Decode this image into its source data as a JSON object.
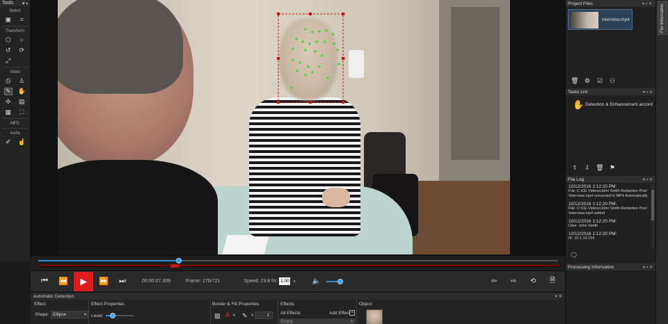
{
  "toolbar": {
    "title": "Tools",
    "sections": {
      "select": "Select",
      "transform": "Transform",
      "video": "Video",
      "mfd": "MFD",
      "audio": "Audio"
    }
  },
  "player": {
    "timecode": "00:00:07.339",
    "frame": "Frame: 176/721",
    "speed_label": "Speed: 23.8 f/s",
    "speed_value": "1.00",
    "progress": 0.27,
    "volume": 0.5
  },
  "bottom_panel": {
    "title": "Automatic Detection",
    "effect_header": "Effect",
    "shape_label": "Shape:",
    "shape_value": "Ellipse",
    "effect_props_header": "Effect Properties",
    "level_label": "Level:",
    "border_header": "Border & Fill Properties",
    "border_value": "1",
    "effects_header": "Effects",
    "all_effects": "All Effects",
    "add_effect": "Add Effect",
    "empty_item": "Empty",
    "object_header": "Object"
  },
  "right_panel": {
    "project_files": {
      "title": "Project Files",
      "file_name": "interview.mp4"
    },
    "tasks": {
      "title": "Tasks List",
      "task": "Detection & Enhancement accord"
    },
    "file_log": {
      "title": "File Log",
      "entries": [
        {
          "date": "10/12/2016 1:12:20 PM:",
          "line1": "File: C:\\CE Videos\\John Smith Redaction Pool",
          "line2": "\\interview.mp4 converted to MP4 Automatically"
        },
        {
          "date": "10/12/2016 1:12:20 PM:",
          "line1": "File: C:\\CE Videos\\John Smith Redaction Pool",
          "line2": "\\interview.mp4 added"
        },
        {
          "date": "10/12/2016 1:12:20 PM:",
          "line1": "User: John Smith",
          "line2": ""
        },
        {
          "date": "10/12/2016 1:12:20 PM:",
          "line1": "IP: 10.1.10.154",
          "line2": ""
        }
      ]
    },
    "processing": {
      "title": "Processing Information"
    },
    "info_tab": "File Information"
  },
  "colors": {
    "accent": "#2d8fd6",
    "play": "#e01b1b",
    "detect_box": "#d01010",
    "landmark": "#33dd33"
  }
}
